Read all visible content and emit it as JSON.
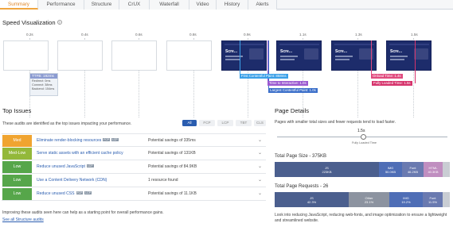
{
  "tabs": [
    "Summary",
    "Performance",
    "Structure",
    "CrUX",
    "Waterfall",
    "Video",
    "History",
    "Alerts"
  ],
  "speed": {
    "title": "Speed Visualization",
    "ticks": [
      "0.2s",
      "0.4s",
      "0.6s",
      "0.8s",
      "0.9s",
      "1.1s",
      "1.3s",
      "1.5s"
    ],
    "ttfb_label": "TTFB: 192ms",
    "ttfb_details": [
      "Redirect: 0ms",
      "Connect: 38ms",
      "Backend: 154ms"
    ],
    "frame_title": "Scre...",
    "markers": {
      "fcp": "First Contentful Paint: 858ms",
      "tti": "Time to Interactive: 1.0s",
      "lcp": "Largest Contentful Paint: 1.0s",
      "onload": "Onload Time: 1.4s",
      "fully": "Fully Loaded Time: 1.5s"
    },
    "colors": {
      "fcp": "#3aa0e8",
      "tti": "#9b59d0",
      "lcp": "#3a6ec9",
      "onload": "#e04a7e",
      "fully": "#d6336c"
    }
  },
  "issues": {
    "title": "Top Issues",
    "subtitle": "These audits are identified as the top issues impacting your performance.",
    "filters": [
      "All",
      "FCP",
      "LCP",
      "TBT",
      "CLS"
    ],
    "rows": [
      {
        "severity": "Med",
        "color": "#f0a430",
        "title": "Eliminate render-blocking resources",
        "badges": [
          "FCP",
          "LCP"
        ],
        "impact": "Potential savings of 335ms"
      },
      {
        "severity": "Med-Low",
        "color": "#93b83a",
        "title": "Serve static assets with an efficient cache policy",
        "badges": [],
        "impact": "Potential savings of 131KB"
      },
      {
        "severity": "Low",
        "color": "#56a64a",
        "title": "Reduce unused JavaScript",
        "badges": [
          "LCP"
        ],
        "impact": "Potential savings of 84.9KB"
      },
      {
        "severity": "Low",
        "color": "#56a64a",
        "title": "Use a Content Delivery Network (CDN)",
        "badges": [],
        "impact": "1 resource found"
      },
      {
        "severity": "Low",
        "color": "#56a64a",
        "title": "Reduce unused CSS",
        "badges": [
          "FCP",
          "LCP"
        ],
        "impact": "Potential savings of 11.1KB"
      }
    ],
    "footer": "Improving these audits seen here can help as a starting point for overall performance gains.",
    "footer_link": "See all Structure audits"
  },
  "details": {
    "title": "Page Details",
    "subtitle": "Pages with smaller total sizes and fewer requests tend to load faster.",
    "fully_loaded_value": "1.5s",
    "fully_loaded_label": "Fully Loaded Time",
    "size_title": "Total Page Size - 375KB",
    "size_segments": [
      {
        "name": "JS",
        "value": "223KB",
        "fraction": 0.595,
        "color": "#4b5f8e"
      },
      {
        "name": "IMG",
        "value": "50.0KB",
        "fraction": 0.133,
        "color": "#4f6eb6"
      },
      {
        "name": "Font",
        "value": "46.2KB",
        "fraction": 0.123,
        "color": "#6a7ab0"
      },
      {
        "name": "HTML",
        "value": "40.3KB",
        "fraction": 0.107,
        "color": "#c08ec0"
      },
      {
        "name": "",
        "value": "",
        "fraction": 0.042,
        "color": "#c9cdd3"
      }
    ],
    "requests_title": "Total Page Requests - 26",
    "requests_segments": [
      {
        "name": "JS",
        "value": "42.3%",
        "fraction": 0.423,
        "color": "#4b5f8e"
      },
      {
        "name": "Other",
        "value": "23.1%",
        "fraction": 0.231,
        "color": "#8c93a0"
      },
      {
        "name": "IMG",
        "value": "19.2%",
        "fraction": 0.192,
        "color": "#4f6eb6"
      },
      {
        "name": "Font",
        "value": "11.5%",
        "fraction": 0.115,
        "color": "#6a7ab0"
      },
      {
        "name": "",
        "value": "",
        "fraction": 0.039,
        "color": "#c9cdd3"
      }
    ],
    "note": "Look into reducing JavaScript, reducing web-fonts, and image optimization to ensure a lightweight and streamlined website."
  }
}
